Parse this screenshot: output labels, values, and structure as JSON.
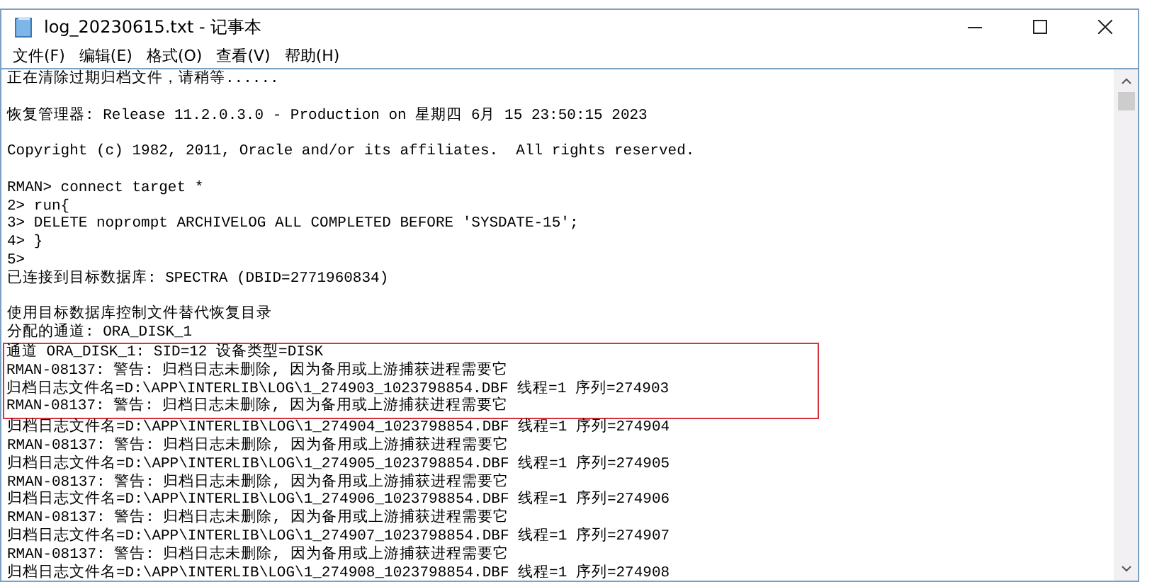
{
  "window": {
    "title": "log_20230615.txt - 记事本"
  },
  "menu": [
    "文件(F)",
    "编辑(E)",
    "格式(O)",
    "查看(V)",
    "帮助(H)"
  ],
  "blocks": [
    [
      {
        "text": "正在清除过期归档文件，请稍等......",
        "highlighted": false
      }
    ],
    [
      {
        "text": "恢复管理器: Release 11.2.0.3.0 - Production on 星期四 6月 15 23:50:15 2023",
        "highlighted": false
      }
    ],
    [
      {
        "text": "Copyright (c) 1982, 2011, Oracle and/or its affiliates.  All rights reserved.",
        "highlighted": false
      }
    ],
    [
      {
        "text": "RMAN> connect target *",
        "highlighted": false
      },
      {
        "text": "2> run{",
        "highlighted": false
      },
      {
        "text": "3> DELETE noprompt ARCHIVELOG ALL COMPLETED BEFORE 'SYSDATE-15';",
        "highlighted": false
      },
      {
        "text": "4> }",
        "highlighted": false
      },
      {
        "text": "5>",
        "highlighted": false
      },
      {
        "text": "已连接到目标数据库: SPECTRA (DBID=2771960834)",
        "highlighted": false
      }
    ],
    [
      {
        "text": "使用目标数据库控制文件替代恢复目录",
        "highlighted": false
      },
      {
        "text": "分配的通道: ORA_DISK_1",
        "highlighted": false
      },
      {
        "text": "通道 ORA_DISK_1: SID=12 设备类型=DISK",
        "highlighted": true
      },
      {
        "text": "RMAN-08137: 警告: 归档日志未删除, 因为备用或上游捕获进程需要它",
        "highlighted": true
      },
      {
        "text": "归档日志文件名=D:\\APP\\INTERLIB\\LOG\\1_274903_1023798854.DBF 线程=1 序列=274903",
        "highlighted": true
      },
      {
        "text": "RMAN-08137: 警告: 归档日志未删除, 因为备用或上游捕获进程需要它",
        "highlighted": true
      },
      {
        "text": "归档日志文件名=D:\\APP\\INTERLIB\\LOG\\1_274904_1023798854.DBF 线程=1 序列=274904",
        "highlighted": false
      },
      {
        "text": "RMAN-08137: 警告: 归档日志未删除, 因为备用或上游捕获进程需要它",
        "highlighted": false
      },
      {
        "text": "归档日志文件名=D:\\APP\\INTERLIB\\LOG\\1_274905_1023798854.DBF 线程=1 序列=274905",
        "highlighted": false
      },
      {
        "text": "RMAN-08137: 警告: 归档日志未删除, 因为备用或上游捕获进程需要它",
        "highlighted": false
      },
      {
        "text": "归档日志文件名=D:\\APP\\INTERLIB\\LOG\\1_274906_1023798854.DBF 线程=1 序列=274906",
        "highlighted": false
      },
      {
        "text": "RMAN-08137: 警告: 归档日志未删除, 因为备用或上游捕获进程需要它",
        "highlighted": false
      },
      {
        "text": "归档日志文件名=D:\\APP\\INTERLIB\\LOG\\1_274907_1023798854.DBF 线程=1 序列=274907",
        "highlighted": false
      },
      {
        "text": "RMAN-08137: 警告: 归档日志未删除, 因为备用或上游捕获进程需要它",
        "highlighted": false
      },
      {
        "text": "归档日志文件名=D:\\APP\\INTERLIB\\LOG\\1_274908_1023798854.DBF 线程=1 序列=274908",
        "highlighted": false
      }
    ]
  ]
}
